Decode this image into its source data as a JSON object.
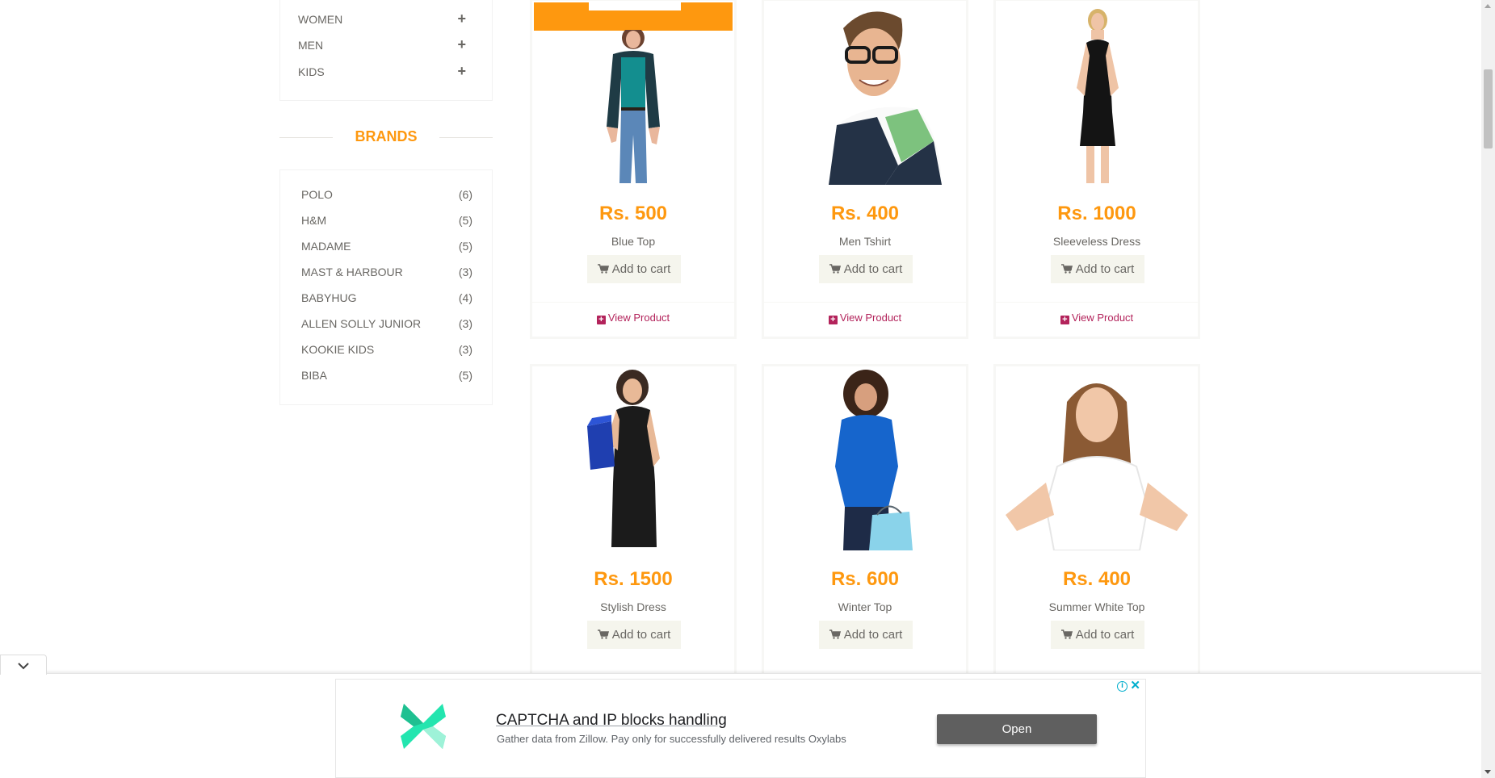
{
  "sidebar": {
    "categories": [
      {
        "label": "WOMEN",
        "expand_icon": "plus-icon"
      },
      {
        "label": "MEN",
        "expand_icon": "plus-icon"
      },
      {
        "label": "KIDS",
        "expand_icon": "plus-icon"
      }
    ],
    "brands_title": "BRANDS",
    "brands": [
      {
        "name": "POLO",
        "count": "(6)"
      },
      {
        "name": "H&M",
        "count": "(5)"
      },
      {
        "name": "MADAME",
        "count": "(5)"
      },
      {
        "name": "MAST & HARBOUR",
        "count": "(3)"
      },
      {
        "name": "BABYHUG",
        "count": "(4)"
      },
      {
        "name": "ALLEN SOLLY JUNIOR",
        "count": "(3)"
      },
      {
        "name": "KOOKIE KIDS",
        "count": "(3)"
      },
      {
        "name": "BIBA",
        "count": "(5)"
      }
    ]
  },
  "products": [
    {
      "price": "Rs. 500",
      "name": "Blue Top",
      "cart_label": "Add to cart",
      "view_label": "View Product"
    },
    {
      "price": "Rs. 400",
      "name": "Men Tshirt",
      "cart_label": "Add to cart",
      "view_label": "View Product"
    },
    {
      "price": "Rs. 1000",
      "name": "Sleeveless Dress",
      "cart_label": "Add to cart",
      "view_label": "View Product"
    },
    {
      "price": "Rs. 1500",
      "name": "Stylish Dress",
      "cart_label": "Add to cart"
    },
    {
      "price": "Rs. 600",
      "name": "Winter Top",
      "cart_label": "Add to cart"
    },
    {
      "price": "Rs. 400",
      "name": "Summer White Top",
      "cart_label": "Add to cart"
    }
  ],
  "ad": {
    "headline": "CAPTCHA and IP blocks handling",
    "description": "Gather data from Zillow. Pay only for successfully delivered results Oxylabs",
    "open_label": "Open",
    "adchoice_glyph": "i",
    "close_glyph": "✕",
    "logo_colors": [
      "#23e5af",
      "#1fc091"
    ]
  },
  "colors": {
    "accent": "#fe980f",
    "view_product": "#b3235b"
  }
}
